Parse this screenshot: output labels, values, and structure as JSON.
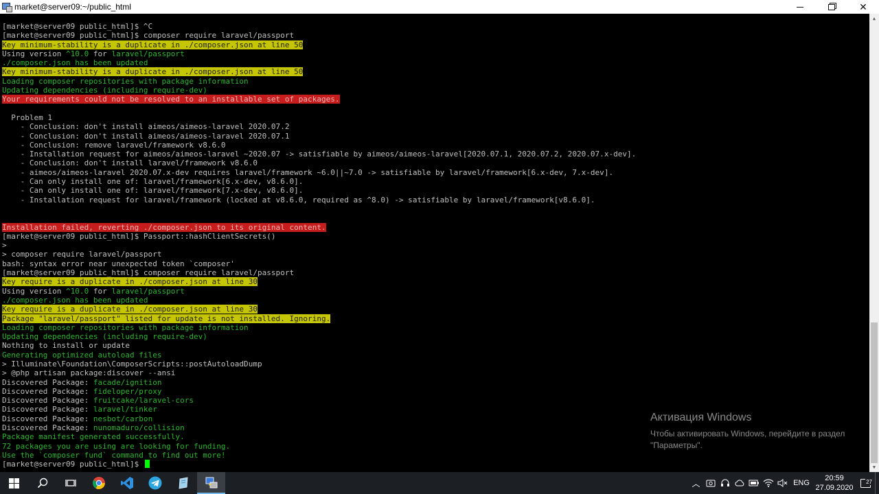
{
  "window": {
    "title": "market@server09:~/public_html"
  },
  "terminal": {
    "lines": [
      [
        {
          "t": "[market@server09 public_html]$ ^C",
          "c": "white"
        }
      ],
      [
        {
          "t": "[market@server09 public_html]$ composer require laravel/passport",
          "c": "white"
        }
      ],
      [
        {
          "t": "Key minimum-stability is a duplicate in ./composer.json at line 50",
          "c": "hl-yellow"
        }
      ],
      [
        {
          "t": "Using version ",
          "c": "white"
        },
        {
          "t": "^10.0",
          "c": "green"
        },
        {
          "t": " for ",
          "c": "white"
        },
        {
          "t": "laravel/passport",
          "c": "green"
        }
      ],
      [
        {
          "t": "./composer.json has been updated",
          "c": "green"
        }
      ],
      [
        {
          "t": "Key minimum-stability is a duplicate in ./composer.json at line 50",
          "c": "hl-yellow"
        }
      ],
      [
        {
          "t": "Loading composer repositories with package information",
          "c": "green"
        }
      ],
      [
        {
          "t": "Updating dependencies (including require-dev)",
          "c": "green"
        }
      ],
      [
        {
          "t": "Your requirements could not be resolved to an installable set of packages.",
          "c": "hl-red"
        }
      ],
      [
        {
          "t": "",
          "c": "white"
        }
      ],
      [
        {
          "t": "  Problem 1",
          "c": "white"
        }
      ],
      [
        {
          "t": "    - Conclusion: don't install aimeos/aimeos-laravel 2020.07.2",
          "c": "white"
        }
      ],
      [
        {
          "t": "    - Conclusion: don't install aimeos/aimeos-laravel 2020.07.1",
          "c": "white"
        }
      ],
      [
        {
          "t": "    - Conclusion: remove laravel/framework v8.6.0",
          "c": "white"
        }
      ],
      [
        {
          "t": "    - Installation request for aimeos/aimeos-laravel ~2020.07 -> satisfiable by aimeos/aimeos-laravel[2020.07.1, 2020.07.2, 2020.07.x-dev].",
          "c": "white"
        }
      ],
      [
        {
          "t": "    - Conclusion: don't install laravel/framework v8.6.0",
          "c": "white"
        }
      ],
      [
        {
          "t": "    - aimeos/aimeos-laravel 2020.07.x-dev requires laravel/framework ~6.0||~7.0 -> satisfiable by laravel/framework[6.x-dev, 7.x-dev].",
          "c": "white"
        }
      ],
      [
        {
          "t": "    - Can only install one of: laravel/framework[6.x-dev, v8.6.0].",
          "c": "white"
        }
      ],
      [
        {
          "t": "    - Can only install one of: laravel/framework[7.x-dev, v8.6.0].",
          "c": "white"
        }
      ],
      [
        {
          "t": "    - Installation request for laravel/framework (locked at v8.6.0, required as ^8.0) -> satisfiable by laravel/framework[v8.6.0].",
          "c": "white"
        }
      ],
      [
        {
          "t": "",
          "c": "white"
        }
      ],
      [
        {
          "t": "",
          "c": "white"
        }
      ],
      [
        {
          "t": "Installation failed, reverting ./composer.json to its original content.",
          "c": "hl-red"
        }
      ],
      [
        {
          "t": "[market@server09 public_html]$ Passport::hashClientSecrets()",
          "c": "white"
        }
      ],
      [
        {
          "t": ">",
          "c": "white"
        }
      ],
      [
        {
          "t": "> composer require laravel/passport",
          "c": "white"
        }
      ],
      [
        {
          "t": "bash: syntax error near unexpected token `composer'",
          "c": "white"
        }
      ],
      [
        {
          "t": "[market@server09 public_html]$ composer require laravel/passport",
          "c": "white"
        }
      ],
      [
        {
          "t": "Key require is a duplicate in ./composer.json at line 30",
          "c": "hl-yellow"
        }
      ],
      [
        {
          "t": "Using version ",
          "c": "white"
        },
        {
          "t": "^10.0",
          "c": "green"
        },
        {
          "t": " for ",
          "c": "white"
        },
        {
          "t": "laravel/passport",
          "c": "green"
        }
      ],
      [
        {
          "t": "./composer.json has been updated",
          "c": "green"
        }
      ],
      [
        {
          "t": "Key require is a duplicate in ./composer.json at line 30",
          "c": "hl-yellow"
        }
      ],
      [
        {
          "t": "Package \"laravel/passport\" listed for update is not installed. Ignoring.",
          "c": "hl-yellow"
        }
      ],
      [
        {
          "t": "Loading composer repositories with package information",
          "c": "green"
        }
      ],
      [
        {
          "t": "Updating dependencies (including require-dev)",
          "c": "green"
        }
      ],
      [
        {
          "t": "Nothing to install or update",
          "c": "white"
        }
      ],
      [
        {
          "t": "Generating optimized autoload files",
          "c": "green"
        }
      ],
      [
        {
          "t": "> Illuminate\\Foundation\\ComposerScripts::postAutoloadDump",
          "c": "white"
        }
      ],
      [
        {
          "t": "> @php artisan package:discover --ansi",
          "c": "white"
        }
      ],
      [
        {
          "t": "Discovered Package: ",
          "c": "white"
        },
        {
          "t": "facade/ignition",
          "c": "green"
        }
      ],
      [
        {
          "t": "Discovered Package: ",
          "c": "white"
        },
        {
          "t": "fideloper/proxy",
          "c": "green"
        }
      ],
      [
        {
          "t": "Discovered Package: ",
          "c": "white"
        },
        {
          "t": "fruitcake/laravel-cors",
          "c": "green"
        }
      ],
      [
        {
          "t": "Discovered Package: ",
          "c": "white"
        },
        {
          "t": "laravel/tinker",
          "c": "green"
        }
      ],
      [
        {
          "t": "Discovered Package: ",
          "c": "white"
        },
        {
          "t": "nesbot/carbon",
          "c": "green"
        }
      ],
      [
        {
          "t": "Discovered Package: ",
          "c": "white"
        },
        {
          "t": "nunomaduro/collision",
          "c": "green"
        }
      ],
      [
        {
          "t": "Package manifest generated successfully.",
          "c": "green"
        }
      ],
      [
        {
          "t": "72 packages you are using are looking for funding.",
          "c": "green"
        }
      ],
      [
        {
          "t": "Use the `composer fund` command to find out more!",
          "c": "green"
        }
      ],
      [
        {
          "t": "[market@server09 public_html]$ ",
          "c": "white"
        }
      ]
    ]
  },
  "watermark": {
    "title": "Активация Windows",
    "text": "Чтобы активировать Windows, перейдите в раздел \"Параметры\"."
  },
  "taskbar": {
    "lang": "ENG",
    "time": "20:59",
    "date": "27.09.2020",
    "notification_count": "27"
  },
  "colors": {
    "terminal_bg": "#000000",
    "text": "#c0c0c0",
    "green": "#2fb52f",
    "yellow_highlight": "#c5c500",
    "red_highlight": "#c81d1d",
    "cursor": "#00ff00",
    "taskbar": "#1c1f24"
  }
}
